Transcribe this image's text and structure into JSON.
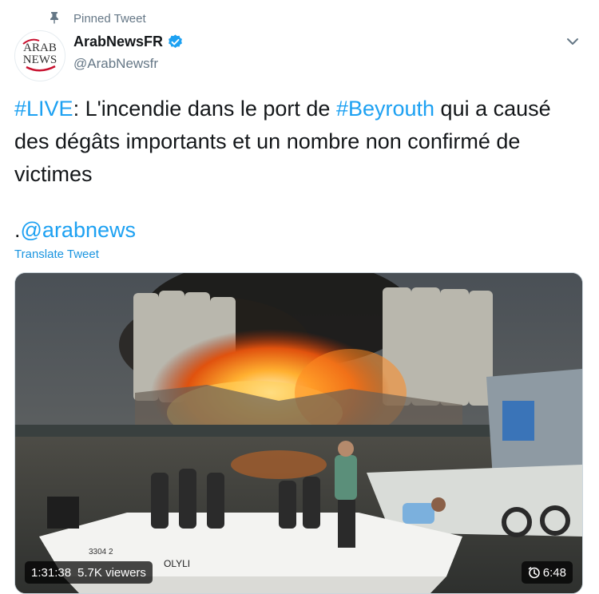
{
  "pinned": {
    "label": "Pinned Tweet",
    "icon": "pin-icon"
  },
  "author": {
    "avatar_text_line1": "ARAB",
    "avatar_text_line2": "NEWS",
    "display_name": "ArabNewsFR",
    "handle": "@ArabNewsfr",
    "verified": true
  },
  "tweet": {
    "hashtag_live": "#LIVE",
    "text_part1": ": L'incendie dans le port de ",
    "hashtag_city": "#Beyrouth",
    "text_part2": " qui a causé des dégâts importants et un nombre non confirmé de victimes",
    "mention_prefix": ".",
    "mention": "@arabnews",
    "translate_label": "Translate Tweet"
  },
  "media": {
    "elapsed": "1:31:38",
    "viewers": "5.7K viewers",
    "duration": "6:48",
    "boat_name": "OLYLI",
    "boat_reg": "3304 2"
  },
  "colors": {
    "link": "#1da1f2",
    "muted": "#657786",
    "verified": "#1da1f2"
  }
}
